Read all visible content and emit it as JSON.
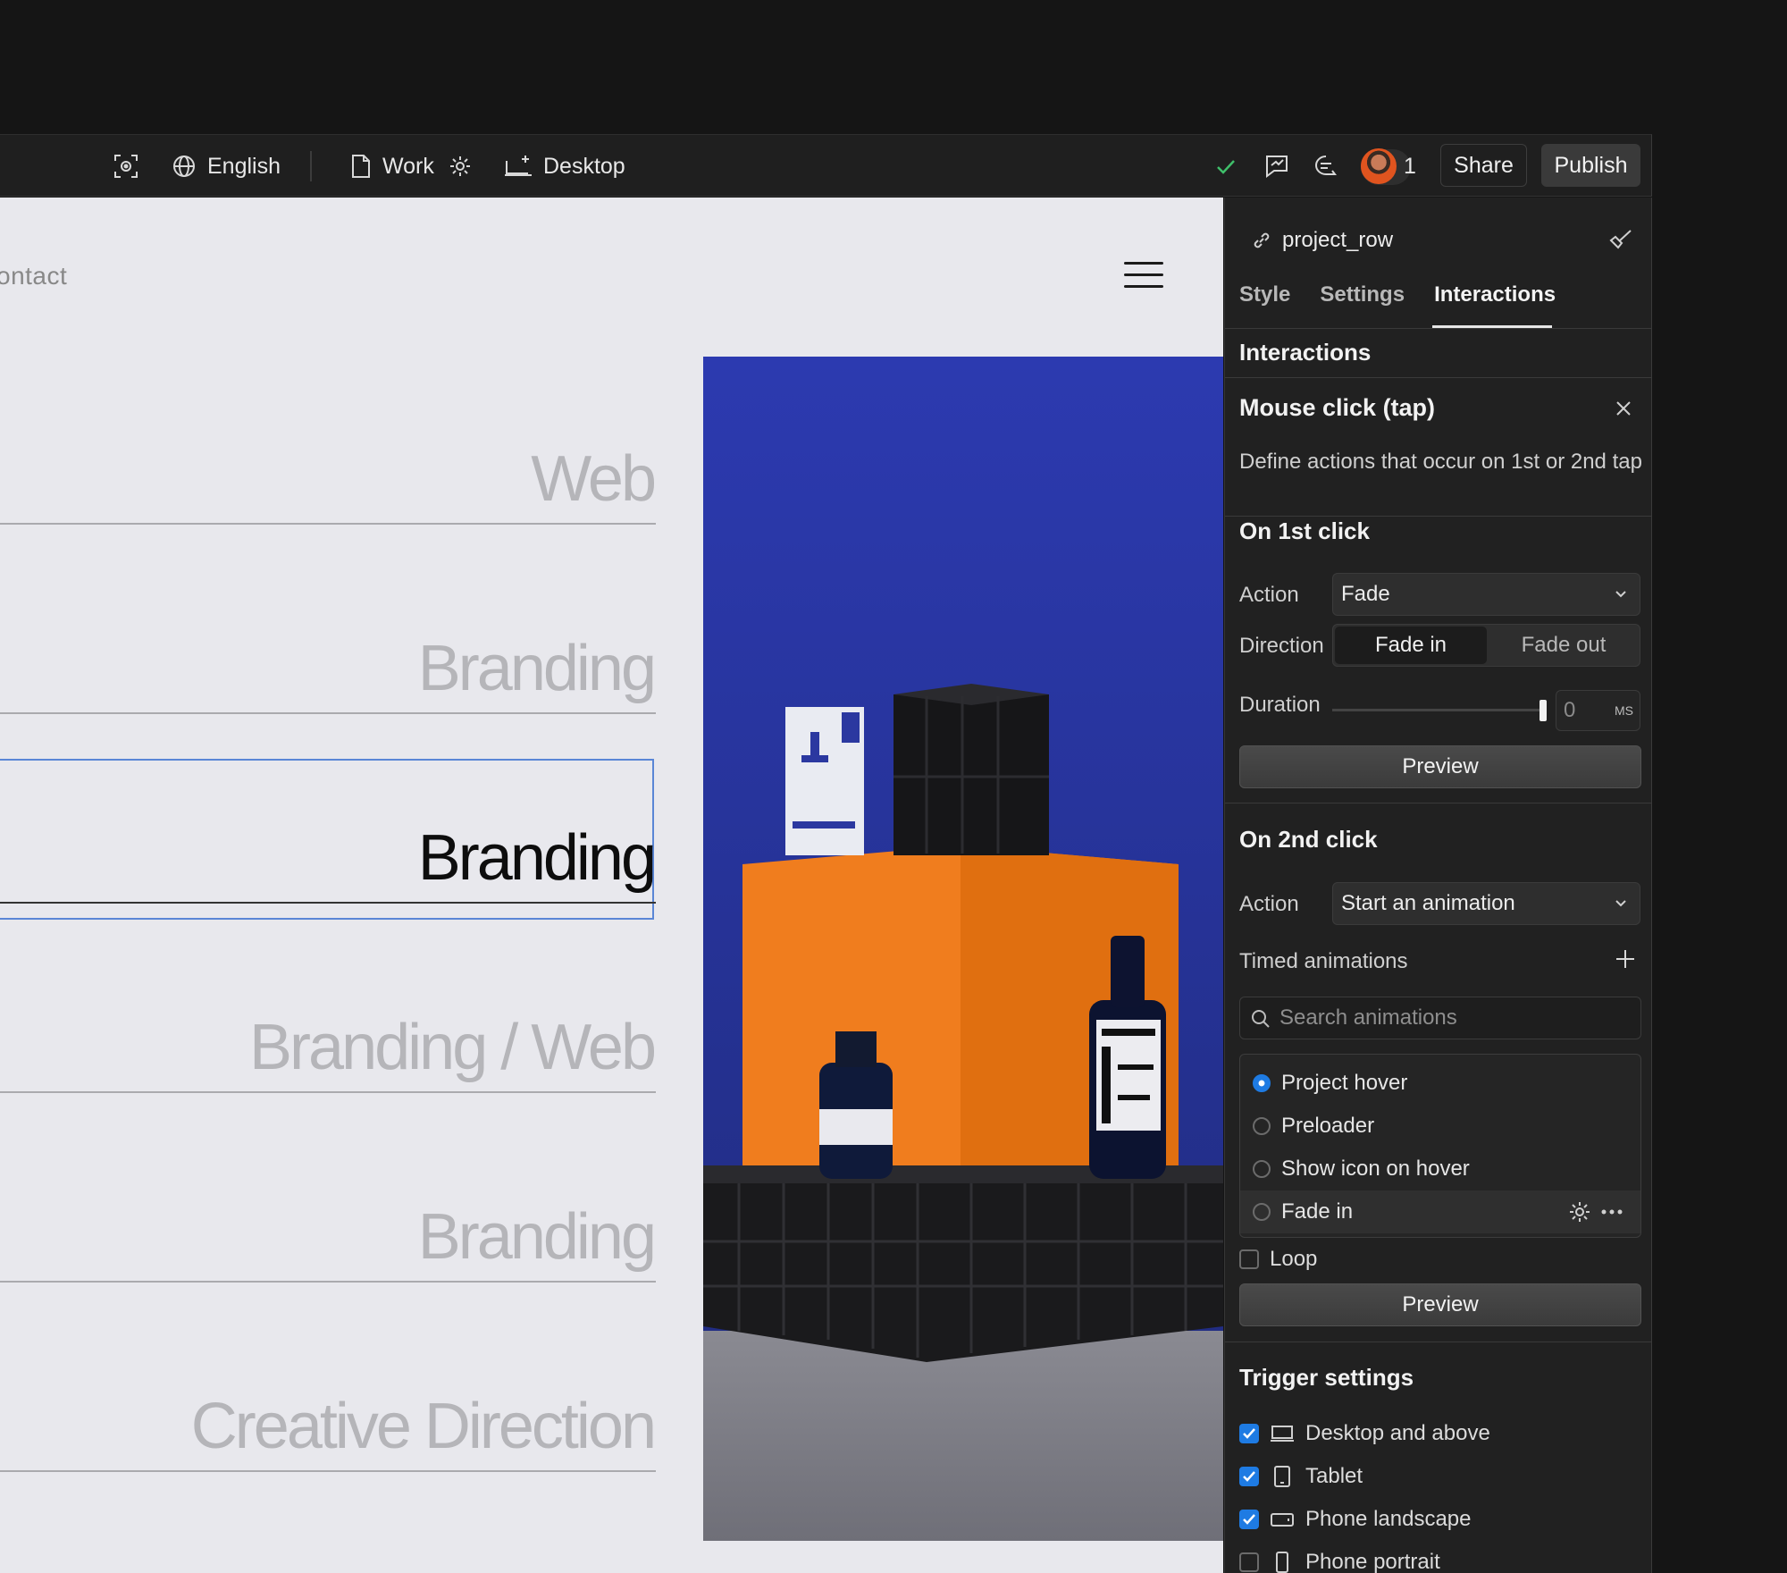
{
  "toolbar": {
    "locale": "English",
    "page": "Work",
    "breakpoint": "Desktop",
    "collaborators_count": "1",
    "share_label": "Share",
    "publish_label": "Publish"
  },
  "canvas": {
    "nav_link": "ontact",
    "projects": [
      {
        "label": "Web",
        "active": false
      },
      {
        "label": "Branding",
        "active": false
      },
      {
        "label": "Branding",
        "active": true
      },
      {
        "label": "Branding / Web",
        "active": false
      },
      {
        "label": "Branding",
        "active": false
      },
      {
        "label": "Creative Direction",
        "active": false
      }
    ]
  },
  "panel": {
    "element_name": "project_row",
    "tabs": [
      "Style",
      "Settings",
      "Interactions"
    ],
    "active_tab": "Interactions",
    "section_title": "Interactions",
    "trigger": {
      "title": "Mouse click (tap)",
      "description": "Define actions that occur on 1st or 2nd tap"
    },
    "first_click": {
      "title": "On 1st click",
      "action_label": "Action",
      "action_value": "Fade",
      "direction_label": "Direction",
      "direction_options": [
        "Fade in",
        "Fade out"
      ],
      "direction_selected": "Fade in",
      "duration_label": "Duration",
      "duration_value": "0",
      "duration_unit": "MS",
      "preview_label": "Preview"
    },
    "second_click": {
      "title": "On 2nd click",
      "action_label": "Action",
      "action_value": "Start an animation",
      "timed_label": "Timed animations",
      "search_placeholder": "Search animations",
      "animations": [
        {
          "name": "Project hover",
          "selected": true
        },
        {
          "name": "Preloader",
          "selected": false
        },
        {
          "name": "Show icon on hover",
          "selected": false
        },
        {
          "name": "Fade in",
          "selected": false
        }
      ],
      "loop_label": "Loop",
      "preview_label": "Preview"
    },
    "trigger_settings": {
      "title": "Trigger settings",
      "devices": [
        {
          "label": "Desktop and above",
          "checked": true,
          "icon": "desktop-icon"
        },
        {
          "label": "Tablet",
          "checked": true,
          "icon": "tablet-icon"
        },
        {
          "label": "Phone landscape",
          "checked": true,
          "icon": "phone-landscape-icon"
        },
        {
          "label": "Phone portrait",
          "checked": false,
          "icon": "phone-portrait-icon"
        }
      ]
    }
  },
  "colors": {
    "accent": "#1e7be3",
    "photo_bg": "#2a3aa0",
    "orange_box": "#f07d1e",
    "check_green": "#3fbf6a"
  }
}
